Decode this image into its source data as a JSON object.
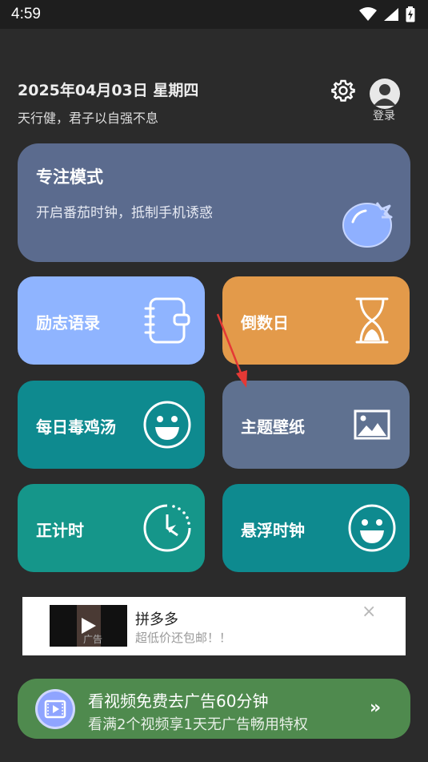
{
  "status": {
    "time": "4:59"
  },
  "header": {
    "date": "2025年04月03日 星期四",
    "motto": "天行健，君子以自强不息",
    "login": "登录"
  },
  "focus": {
    "title": "专注模式",
    "subtitle": "开启番茄时钟，抵制手机诱惑"
  },
  "tiles": [
    {
      "label": "励志语录",
      "color": "#8fb4ff",
      "icon": "notebook-icon"
    },
    {
      "label": "倒数日",
      "color": "#e39a4a",
      "icon": "hourglass-icon"
    },
    {
      "label": "每日毒鸡汤",
      "color": "#0e8a8f",
      "icon": "smiley-icon"
    },
    {
      "label": "主题壁纸",
      "color": "#5f7190",
      "icon": "image-icon"
    },
    {
      "label": "正计时",
      "color": "#15968a",
      "icon": "clock-icon"
    },
    {
      "label": "悬浮时钟",
      "color": "#0e8a8f",
      "icon": "smiley-icon"
    }
  ],
  "ad": {
    "title": "拼多多",
    "subtitle": "超低价还包邮！！",
    "tag": "广告",
    "close": "×"
  },
  "vip": {
    "title": "看视频免费去广告60分钟",
    "subtitle": "看满2个视频享1天无广告畅用特权",
    "arrow": "»"
  }
}
